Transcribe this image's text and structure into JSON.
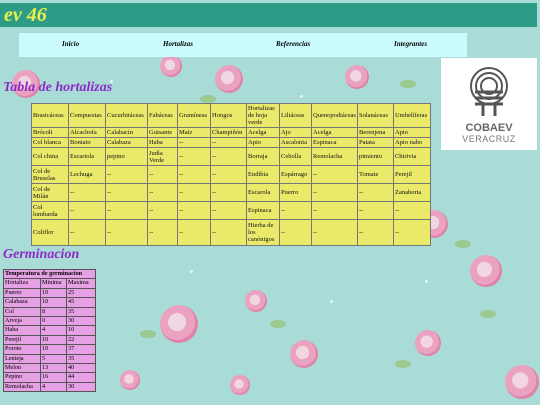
{
  "header": {
    "title": "ev 46"
  },
  "nav": [
    {
      "label": "Inicio"
    },
    {
      "label": "Hortalizas"
    },
    {
      "label": "Referencias"
    },
    {
      "label": "Integrantes"
    }
  ],
  "logo": {
    "brand": "COBAEV",
    "sub": "VERACRUZ"
  },
  "veg_section": {
    "title": "Tabla de hortalizas",
    "rows": [
      [
        "Brasicáceas",
        "Compuestas",
        "Cucurbitáceas",
        "Fabáceas",
        "Gramíneas",
        "Hongos",
        "Hortalizas de hoja verde",
        "Liliáceas",
        "Quenopodiáceas",
        "Solanáceas",
        "Umbelíferas"
      ],
      [
        "Brócoli",
        "Alcachofa",
        "Calabacín",
        "Guisante",
        "Maíz",
        "Champiñón",
        "Acelga",
        "Ajo",
        "Acelga",
        "Berenjena",
        "Apio"
      ],
      [
        "Col blanca",
        "Boniato",
        "Calabaza",
        "Haba",
        "--",
        "--",
        "Apio",
        "Ascalonia",
        "Espinaca",
        "Patata",
        "Apio nabo"
      ],
      [
        "Col china",
        "Escariola",
        "pepino",
        "Judía Verde",
        "--",
        "--",
        "Borraja",
        "Cebolla",
        "Remolacha",
        "pimiento",
        "Chirivia"
      ],
      [
        "Col de Bruselas",
        "Lechuga",
        "--",
        "--",
        "--",
        "--",
        "Endibia",
        "Espárrago",
        "--",
        "Tomate",
        "Perejil"
      ],
      [
        "Col de Milán",
        "--",
        "--",
        "--",
        "--",
        "--",
        "Escarola",
        "Puerro",
        "--",
        "--",
        "Zanahoria"
      ],
      [
        "Col lombarda",
        "--",
        "--",
        "--",
        "--",
        "--",
        "Espinaca",
        "--",
        "--",
        "--",
        "--"
      ],
      [
        "Coliflor",
        "--",
        "--",
        "--",
        "--",
        "--",
        "Hierba de los canónigos",
        "--",
        "--",
        "--",
        "--"
      ]
    ]
  },
  "germ_section": {
    "title": "Germinacion",
    "table_title": "Temperatura de germinacion",
    "headers": [
      "Hortaliza",
      "Minima",
      "Maxima"
    ],
    "rows": [
      [
        "Puerro",
        "10",
        "25"
      ],
      [
        "Calabaza",
        "10",
        "45"
      ],
      [
        "Col",
        "8",
        "35"
      ],
      [
        "Arveja",
        "0",
        "30"
      ],
      [
        "Haba",
        "4",
        "10"
      ],
      [
        "Perejil",
        "10",
        "22"
      ],
      [
        "Poroto",
        "10",
        "37"
      ],
      [
        "Lenteja",
        "5",
        "35"
      ],
      [
        "Melon",
        "13",
        "40"
      ],
      [
        "Pepino",
        "16",
        "44"
      ],
      [
        "Remolacha",
        "4",
        "30"
      ]
    ]
  }
}
